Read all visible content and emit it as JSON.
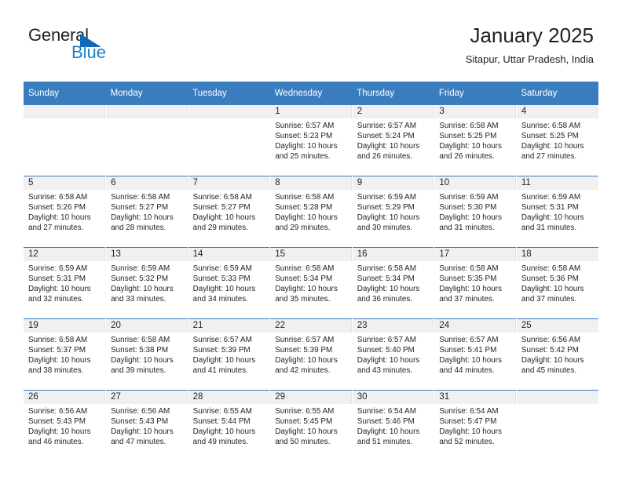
{
  "brand": {
    "name_part1": "General",
    "name_part2": "Blue",
    "triangle_color": "#1268b3",
    "blue_color": "#1f80c8"
  },
  "header": {
    "title": "January 2025",
    "subtitle": "Sitapur, Uttar Pradesh, India"
  },
  "theme": {
    "header_row_bg": "#3a7dbf",
    "header_row_text": "#ffffff",
    "daynum_band_bg": "#f0f0f0",
    "week_separator": "#3a7dbf",
    "text_color": "#231f20"
  },
  "calendar": {
    "weekday_headers": [
      "Sunday",
      "Monday",
      "Tuesday",
      "Wednesday",
      "Thursday",
      "Friday",
      "Saturday"
    ],
    "weeks": [
      [
        {
          "empty": true
        },
        {
          "empty": true
        },
        {
          "empty": true
        },
        {
          "day": "1",
          "sunrise": "Sunrise: 6:57 AM",
          "sunset": "Sunset: 5:23 PM",
          "daylight": "Daylight: 10 hours and 25 minutes."
        },
        {
          "day": "2",
          "sunrise": "Sunrise: 6:57 AM",
          "sunset": "Sunset: 5:24 PM",
          "daylight": "Daylight: 10 hours and 26 minutes."
        },
        {
          "day": "3",
          "sunrise": "Sunrise: 6:58 AM",
          "sunset": "Sunset: 5:25 PM",
          "daylight": "Daylight: 10 hours and 26 minutes."
        },
        {
          "day": "4",
          "sunrise": "Sunrise: 6:58 AM",
          "sunset": "Sunset: 5:25 PM",
          "daylight": "Daylight: 10 hours and 27 minutes."
        }
      ],
      [
        {
          "day": "5",
          "sunrise": "Sunrise: 6:58 AM",
          "sunset": "Sunset: 5:26 PM",
          "daylight": "Daylight: 10 hours and 27 minutes."
        },
        {
          "day": "6",
          "sunrise": "Sunrise: 6:58 AM",
          "sunset": "Sunset: 5:27 PM",
          "daylight": "Daylight: 10 hours and 28 minutes."
        },
        {
          "day": "7",
          "sunrise": "Sunrise: 6:58 AM",
          "sunset": "Sunset: 5:27 PM",
          "daylight": "Daylight: 10 hours and 29 minutes."
        },
        {
          "day": "8",
          "sunrise": "Sunrise: 6:58 AM",
          "sunset": "Sunset: 5:28 PM",
          "daylight": "Daylight: 10 hours and 29 minutes."
        },
        {
          "day": "9",
          "sunrise": "Sunrise: 6:59 AM",
          "sunset": "Sunset: 5:29 PM",
          "daylight": "Daylight: 10 hours and 30 minutes."
        },
        {
          "day": "10",
          "sunrise": "Sunrise: 6:59 AM",
          "sunset": "Sunset: 5:30 PM",
          "daylight": "Daylight: 10 hours and 31 minutes."
        },
        {
          "day": "11",
          "sunrise": "Sunrise: 6:59 AM",
          "sunset": "Sunset: 5:31 PM",
          "daylight": "Daylight: 10 hours and 31 minutes."
        }
      ],
      [
        {
          "day": "12",
          "sunrise": "Sunrise: 6:59 AM",
          "sunset": "Sunset: 5:31 PM",
          "daylight": "Daylight: 10 hours and 32 minutes."
        },
        {
          "day": "13",
          "sunrise": "Sunrise: 6:59 AM",
          "sunset": "Sunset: 5:32 PM",
          "daylight": "Daylight: 10 hours and 33 minutes."
        },
        {
          "day": "14",
          "sunrise": "Sunrise: 6:59 AM",
          "sunset": "Sunset: 5:33 PM",
          "daylight": "Daylight: 10 hours and 34 minutes."
        },
        {
          "day": "15",
          "sunrise": "Sunrise: 6:58 AM",
          "sunset": "Sunset: 5:34 PM",
          "daylight": "Daylight: 10 hours and 35 minutes."
        },
        {
          "day": "16",
          "sunrise": "Sunrise: 6:58 AM",
          "sunset": "Sunset: 5:34 PM",
          "daylight": "Daylight: 10 hours and 36 minutes."
        },
        {
          "day": "17",
          "sunrise": "Sunrise: 6:58 AM",
          "sunset": "Sunset: 5:35 PM",
          "daylight": "Daylight: 10 hours and 37 minutes."
        },
        {
          "day": "18",
          "sunrise": "Sunrise: 6:58 AM",
          "sunset": "Sunset: 5:36 PM",
          "daylight": "Daylight: 10 hours and 37 minutes."
        }
      ],
      [
        {
          "day": "19",
          "sunrise": "Sunrise: 6:58 AM",
          "sunset": "Sunset: 5:37 PM",
          "daylight": "Daylight: 10 hours and 38 minutes."
        },
        {
          "day": "20",
          "sunrise": "Sunrise: 6:58 AM",
          "sunset": "Sunset: 5:38 PM",
          "daylight": "Daylight: 10 hours and 39 minutes."
        },
        {
          "day": "21",
          "sunrise": "Sunrise: 6:57 AM",
          "sunset": "Sunset: 5:39 PM",
          "daylight": "Daylight: 10 hours and 41 minutes."
        },
        {
          "day": "22",
          "sunrise": "Sunrise: 6:57 AM",
          "sunset": "Sunset: 5:39 PM",
          "daylight": "Daylight: 10 hours and 42 minutes."
        },
        {
          "day": "23",
          "sunrise": "Sunrise: 6:57 AM",
          "sunset": "Sunset: 5:40 PM",
          "daylight": "Daylight: 10 hours and 43 minutes."
        },
        {
          "day": "24",
          "sunrise": "Sunrise: 6:57 AM",
          "sunset": "Sunset: 5:41 PM",
          "daylight": "Daylight: 10 hours and 44 minutes."
        },
        {
          "day": "25",
          "sunrise": "Sunrise: 6:56 AM",
          "sunset": "Sunset: 5:42 PM",
          "daylight": "Daylight: 10 hours and 45 minutes."
        }
      ],
      [
        {
          "day": "26",
          "sunrise": "Sunrise: 6:56 AM",
          "sunset": "Sunset: 5:43 PM",
          "daylight": "Daylight: 10 hours and 46 minutes."
        },
        {
          "day": "27",
          "sunrise": "Sunrise: 6:56 AM",
          "sunset": "Sunset: 5:43 PM",
          "daylight": "Daylight: 10 hours and 47 minutes."
        },
        {
          "day": "28",
          "sunrise": "Sunrise: 6:55 AM",
          "sunset": "Sunset: 5:44 PM",
          "daylight": "Daylight: 10 hours and 49 minutes."
        },
        {
          "day": "29",
          "sunrise": "Sunrise: 6:55 AM",
          "sunset": "Sunset: 5:45 PM",
          "daylight": "Daylight: 10 hours and 50 minutes."
        },
        {
          "day": "30",
          "sunrise": "Sunrise: 6:54 AM",
          "sunset": "Sunset: 5:46 PM",
          "daylight": "Daylight: 10 hours and 51 minutes."
        },
        {
          "day": "31",
          "sunrise": "Sunrise: 6:54 AM",
          "sunset": "Sunset: 5:47 PM",
          "daylight": "Daylight: 10 hours and 52 minutes."
        },
        {
          "empty": true
        }
      ]
    ]
  }
}
